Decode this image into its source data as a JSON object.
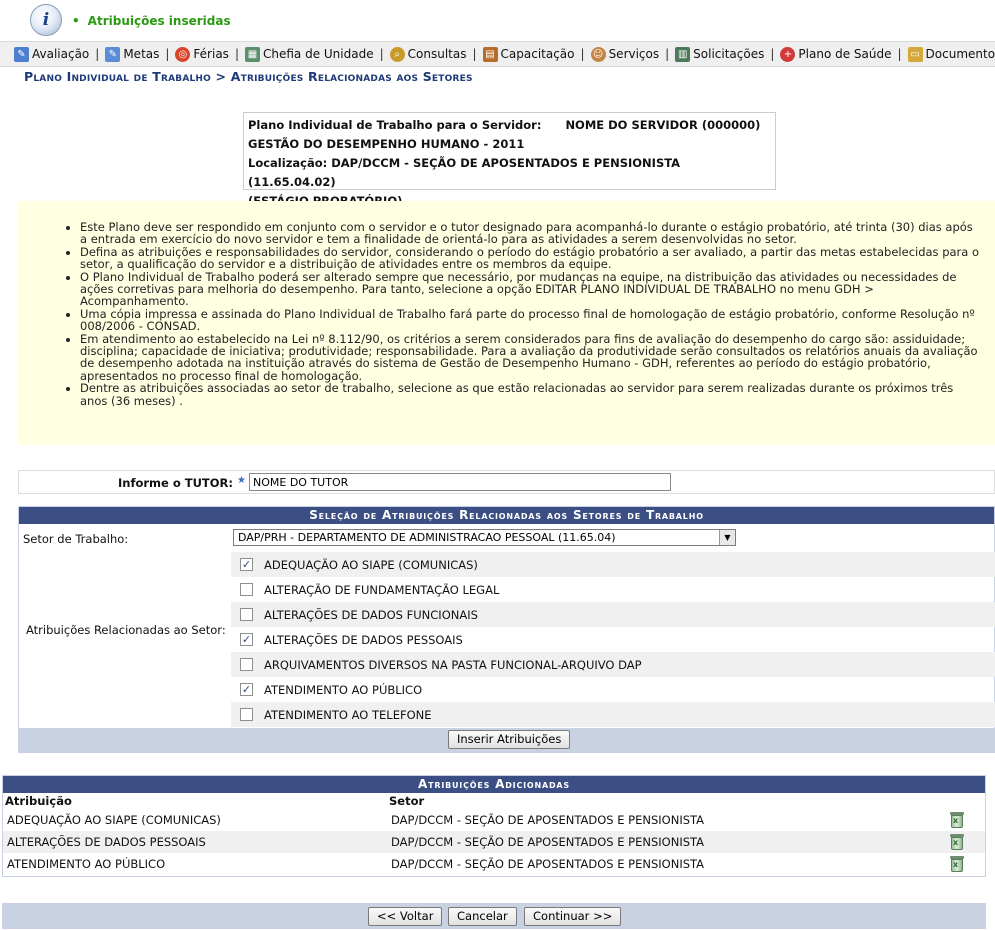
{
  "message": {
    "icon": "info-icon",
    "text": "Atribuições inseridas"
  },
  "menu": [
    {
      "label": "Avaliação",
      "icon": "evaluation-icon",
      "color": "#4c7fcf"
    },
    {
      "label": "Metas",
      "icon": "goals-icon",
      "color": "#5b8cd6"
    },
    {
      "label": "Férias",
      "icon": "lifebuoy-icon",
      "color": "#d9452b"
    },
    {
      "label": "Chefia de Unidade",
      "icon": "org-chart-icon",
      "color": "#5a8f6e"
    },
    {
      "label": "Consultas",
      "icon": "magnifier-icon",
      "color": "#c89a2a"
    },
    {
      "label": "Capacitação",
      "icon": "book-icon",
      "color": "#b46d2a"
    },
    {
      "label": "Serviços",
      "icon": "person-icon",
      "color": "#c38546"
    },
    {
      "label": "Solicitações",
      "icon": "form-icon",
      "color": "#4b7a5b"
    },
    {
      "label": "Plano de Saúde",
      "icon": "health-cross-icon",
      "color": "#d23a3a"
    },
    {
      "label": "Documentos",
      "icon": "folder-icon",
      "color": "#d6a83b"
    }
  ],
  "breadcrumb": "Plano Individual de Trabalho > Atribuições Relacionadas aos Setores",
  "server": {
    "line1_label": "Plano Individual de Trabalho para o Servidor:",
    "line1_value": "NOME DO SERVIDOR (000000)",
    "line2": "GESTÃO DO DESEMPENHO HUMANO - 2011",
    "line3": "Localização: DAP/DCCM - SEÇÃO DE APOSENTADOS E PENSIONISTA (11.65.04.02)",
    "line4": "(ESTÁGIO PROBATÓRIO)"
  },
  "instructions": [
    "Este Plano deve ser respondido em conjunto com o servidor e o tutor designado para acompanhá-lo durante o estágio probatório, até trinta (30) dias após a entrada em exercício do novo servidor e tem a finalidade de orientá-lo para as atividades a serem desenvolvidas no setor.",
    "Defina as atribuições e responsabilidades do servidor, considerando o período do estágio probatório a ser avaliado, a partir das metas estabelecidas para o setor, a qualificação do servidor e a distribuição de atividades entre os membros da equipe.",
    "O Plano Individual de Trabalho poderá ser alterado sempre que necessário, por mudanças na equipe, na distribuição das atividades ou necessidades de ações corretivas para melhoria do desempenho. Para tanto, selecione a opção EDITAR PLANO INDIVIDUAL DE TRABALHO no menu GDH > Acompanhamento.",
    "Uma cópia impressa e assinada do Plano Individual de Trabalho fará parte do processo final de homologação de estágio probatório, conforme Resolução nº 008/2006 - CONSAD.",
    "Em atendimento ao estabelecido na Lei nº 8.112/90, os critérios a serem considerados para fins de avaliação do desempenho do cargo são: assiduidade; disciplina; capacidade de iniciativa; produtividade; responsabilidade. Para a avaliação da produtividade serão consultados os relatórios anuais da avaliação de desempenho adotada na instituição através do sistema de Gestão de Desempenho Humano - GDH, referentes ao período do estágio probatório, apresentados no processo final de homologação.",
    "Dentre as atribuições associadas ao setor de trabalho, selecione as que estão relacionadas ao servidor para serem realizadas durante os próximos três anos (36 meses) ."
  ],
  "tutor": {
    "label": "Informe o TUTOR:",
    "required_mark": "★",
    "value": "NOME DO TUTOR"
  },
  "selection": {
    "caption": "Seleção de Atribuições Relacionadas aos Setores de Trabalho",
    "setor_label": "Setor de Trabalho:",
    "setor_value": "DAP/PRH - DEPARTAMENTO DE ADMINISTRACAO PESSOAL (11.65.04)",
    "attr_label": "Atribuições Relacionadas ao Setor:",
    "items": [
      {
        "label": "ADEQUAÇÃO AO SIAPE (COMUNICAS)",
        "checked": true
      },
      {
        "label": "ALTERAÇÃO DE FUNDAMENTAÇÃO LEGAL",
        "checked": false
      },
      {
        "label": "ALTERAÇÕES DE DADOS FUNCIONAIS",
        "checked": false
      },
      {
        "label": "ALTERAÇÕES DE DADOS PESSOAIS",
        "checked": true
      },
      {
        "label": "ARQUIVAMENTOS DIVERSOS NA PASTA FUNCIONAL-ARQUIVO DAP",
        "checked": false
      },
      {
        "label": "ATENDIMENTO AO PÚBLICO",
        "checked": true
      },
      {
        "label": "ATENDIMENTO AO TELEFONE",
        "checked": false
      }
    ],
    "submit_label": "Inserir Atribuições"
  },
  "added": {
    "caption": "Atribuições Adicionadas",
    "col_attr": "Atribuição",
    "col_setor": "Setor",
    "rows": [
      {
        "attr": "ADEQUAÇÃO AO SIAPE (COMUNICAS)",
        "setor": "DAP/DCCM - SEÇÃO DE APOSENTADOS E PENSIONISTA"
      },
      {
        "attr": "ALTERAÇÕES DE DADOS PESSOAIS",
        "setor": "DAP/DCCM - SEÇÃO DE APOSENTADOS E PENSIONISTA"
      },
      {
        "attr": "ATENDIMENTO AO PÚBLICO",
        "setor": "DAP/DCCM - SEÇÃO DE APOSENTADOS E PENSIONISTA"
      }
    ]
  },
  "buttons": {
    "back": "<< Voltar",
    "cancel": "Cancelar",
    "continue": "Continuar >>"
  }
}
